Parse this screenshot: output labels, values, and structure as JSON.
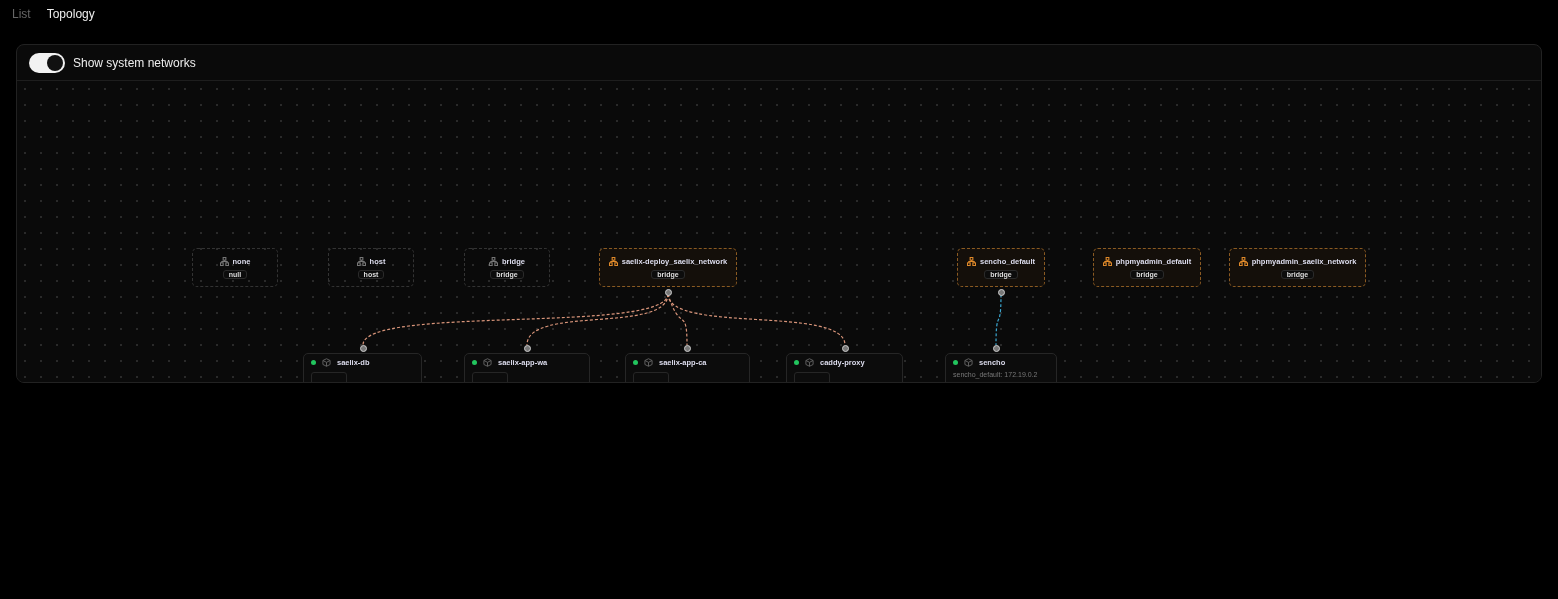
{
  "tabs": [
    {
      "label": "List",
      "selected": false
    },
    {
      "label": "Topology",
      "selected": true
    }
  ],
  "toolbar": {
    "toggle": {
      "label": "Show system networks",
      "on": true
    }
  },
  "networks": [
    {
      "name": "none",
      "driver": "null",
      "kind": "system"
    },
    {
      "name": "host",
      "driver": "host",
      "kind": "system"
    },
    {
      "name": "bridge",
      "driver": "bridge",
      "kind": "system"
    },
    {
      "name": "saelix-deploy_saelix_network",
      "driver": "bridge",
      "kind": "user"
    },
    {
      "name": "sencho_default",
      "driver": "bridge",
      "kind": "user"
    },
    {
      "name": "phpmyadmin_default",
      "driver": "bridge",
      "kind": "user"
    },
    {
      "name": "phpmyadmin_saelix_network",
      "driver": "bridge",
      "kind": "user"
    }
  ],
  "containers": [
    {
      "name": "saelix-db",
      "running": true,
      "color": "#d9957a"
    },
    {
      "name": "saelix-app-wa",
      "running": true,
      "color": "#d9957a"
    },
    {
      "name": "saelix-app-ca",
      "running": true,
      "color": "#d9957a"
    },
    {
      "name": "caddy-proxy",
      "running": true,
      "color": "#d9957a"
    },
    {
      "name": "sencho",
      "running": true,
      "color": "#3ba6cf",
      "address": "sencho_default: 172.19.0.2"
    }
  ]
}
